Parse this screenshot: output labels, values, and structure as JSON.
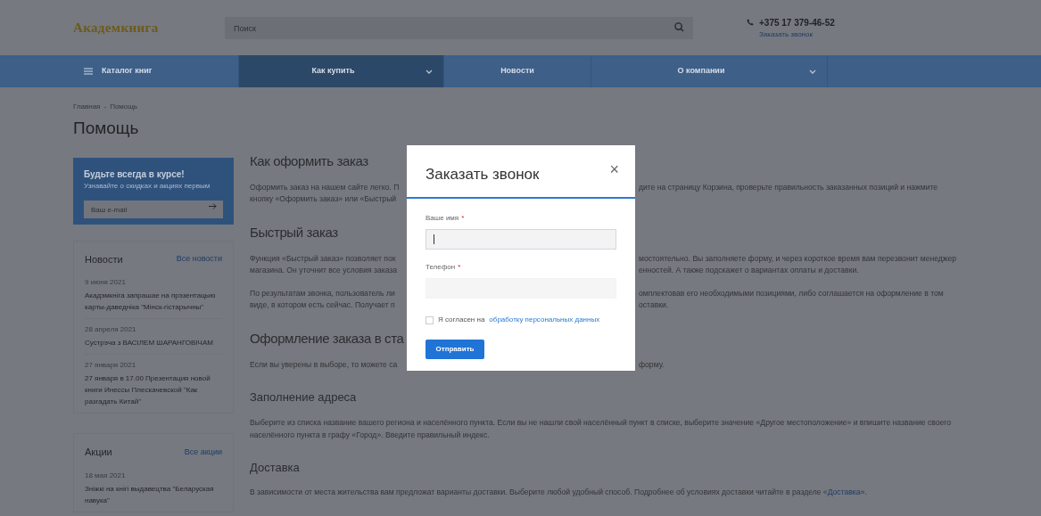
{
  "header": {
    "logo": "Академкнига",
    "search": {
      "placeholder": "Поиск"
    },
    "phone": "+375 17 379-46-52",
    "callback_link": "Заказать звонок"
  },
  "nav": [
    {
      "label": "Каталог книг",
      "kind": "menu",
      "selected": false
    },
    {
      "label": "Как купить",
      "kind": "dropdown",
      "selected": true
    },
    {
      "label": "Новости",
      "kind": "plain",
      "selected": false
    },
    {
      "label": "О компании",
      "kind": "dropdown",
      "selected": false
    }
  ],
  "breadcrumbs": {
    "items": [
      "Главная",
      "Помощь"
    ],
    "separator": "-"
  },
  "page_title": "Помощь",
  "subscribe": {
    "title": "Будьте всегда в курсе!",
    "subtitle": "Узнавайте о скидках и акциях первым",
    "email": {
      "placeholder": "Ваш e-mail"
    }
  },
  "sidebar_blocks": [
    {
      "title": "Новости",
      "link": "Все новости",
      "items": [
        {
          "date": "9 июня 2021",
          "title": "Акадэмкніга запрашае на прэзентацыю карты-даведніка \"Мінск-гістарычны\""
        },
        {
          "date": "28 апреля 2021",
          "title": "Сустрэча з ВАСІЛЕМ ШАРАНГОВІЧАМ"
        },
        {
          "date": "27 января 2021",
          "title": "27 января в 17.00 Презентация новой книги Инессы Плескачевской \"Как разгадать Китай\""
        }
      ]
    },
    {
      "title": "Акции",
      "link": "Все акции",
      "items": [
        {
          "date": "18 мая 2021",
          "title": "Зніжкі на кнігі выдавецтва \"Беларуская навука\""
        }
      ]
    }
  ],
  "content": [
    {
      "kind": "h2",
      "text": "Как оформить заказ"
    },
    {
      "kind": "split",
      "lines": [
        {
          "left": "Оформить заказ на нашем сайте легко. П",
          "right": "дите на страницу Корзина, проверьте правильность заказанных позиций и нажмите"
        },
        {
          "left": "кнопку «Оформить заказ» или «Быстрый"
        }
      ]
    },
    {
      "kind": "h2",
      "text": "Быстрый заказ"
    },
    {
      "kind": "split",
      "lines": [
        {
          "left": "Функция «Быстрый заказ» позволяет пок",
          "right": "мостоятельно. Вы заполняете форму, и через короткое время вам перезвонит менеджер"
        },
        {
          "left": "магазина. Он уточнит все условия заказа",
          "right": "енностей. А также подскажет о вариантах оплаты и доставки."
        }
      ]
    },
    {
      "kind": "split",
      "lines": [
        {
          "left": "По результатам звонка, пользователь ли",
          "right": "омплектовав его необходимыми позициями, либо соглашается на оформление в том"
        },
        {
          "left": "виде, в котором есть сейчас. Получает п",
          "right": "оставки."
        }
      ]
    },
    {
      "kind": "h2",
      "text": "Оформление заказа в ста"
    },
    {
      "kind": "split",
      "lines": [
        {
          "left": "Если вы уверены в выборе, то можете са",
          "right": "форму."
        }
      ]
    },
    {
      "kind": "h3",
      "text": "Заполнение адреса"
    },
    {
      "kind": "p",
      "text": "Выберите из списка название вашего региона и населённого пункта. Если вы не нашли свой населённый пункт в списке, выберите значение «Другое местоположение» и впишите название своего населённого пункта в графу «Город». Введите правильный индекс."
    },
    {
      "kind": "h3",
      "text": "Доставка"
    },
    {
      "kind": "link_p",
      "before": "В зависимости от места жительства вам предложат варианты доставки. Выберите любой удобный способ. Подробнее об условиях доставки читайте в разделе «",
      "link": "Доставка",
      "after": "»."
    }
  ],
  "modal": {
    "title": "Заказать звонок",
    "close": "×",
    "fields": [
      {
        "label": "Ваше имя",
        "required": true,
        "required_mark": "*",
        "focused": true
      },
      {
        "label": "Телефон",
        "required": true,
        "required_mark": "*",
        "focused": false
      }
    ],
    "consent": {
      "checked": false,
      "text": "Я согласен на",
      "link": "обработку персональных данных"
    },
    "submit": "Отправить"
  }
}
